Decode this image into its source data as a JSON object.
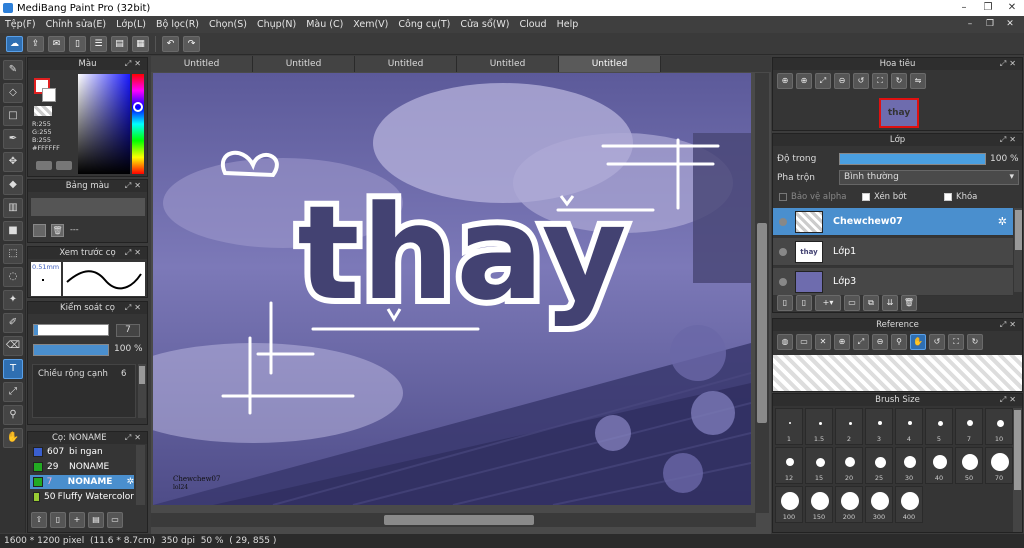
{
  "window": {
    "title": "MediBang Paint Pro (32bit)",
    "controls": [
      "–",
      "❐",
      "✕"
    ]
  },
  "menu": {
    "items": [
      "Tệp(F)",
      "Chỉnh sửa(E)",
      "Lớp(L)",
      "Bộ lọc(R)",
      "Chọn(S)",
      "Chụp(N)",
      "Màu (C)",
      "Xem(V)",
      "Công cụ(T)",
      "Cửa sổ(W)",
      "Cloud",
      "Help"
    ],
    "right_controls": [
      "–",
      "❐",
      "✕"
    ]
  },
  "toolbar": {
    "icons": [
      "cloud-icon",
      "share-icon",
      "comment-icon",
      "page-icon",
      "document-icon",
      "list-icon",
      "grid-icon"
    ],
    "undo_label": "↶",
    "redo_label": "↷"
  },
  "tools": [
    "brush-tool-icon",
    "eraser-icon",
    "rectangle-icon",
    "pen-icon",
    "move-icon",
    "bucket-icon",
    "gradient-icon",
    "fill-rect-icon",
    "select-rect-icon",
    "lasso-icon",
    "magic-wand-icon",
    "select-pen-icon",
    "select-eraser-icon",
    "text-icon",
    "operation-icon",
    "eyedropper-icon",
    "hand-icon"
  ],
  "color_panel": {
    "title": "Màu",
    "r": "R:255",
    "g": "G:255",
    "b": "B:255",
    "hex": "#FFFFFF",
    "fg_color": "#e02020",
    "bg_color": "#ffffff"
  },
  "palette_panel": {
    "title": "Bảng màu",
    "value": "---"
  },
  "brush_preview_panel": {
    "title": "Xem trước cọ",
    "size": "0.51mm"
  },
  "brush_control_panel": {
    "title": "Kiểm soát cọ",
    "size_value": "7",
    "opacity_value": "100 %",
    "option_label": "Chiều rộng cạnh",
    "option_value": "6",
    "size_fraction": 0.06,
    "opacity_fraction": 1.0
  },
  "brush_list_panel": {
    "title": "Cọ: NONAME",
    "items": [
      {
        "num": "607",
        "name": "bi ngan",
        "color": "#3a5fcf"
      },
      {
        "num": "29",
        "name": "NONAME",
        "color": "#22aa22"
      },
      {
        "num": "7",
        "name": "NONAME",
        "color": "#22aa22"
      },
      {
        "num": "50",
        "name": "Fluffy Watercolor",
        "color": "#99cc33"
      }
    ],
    "selected_index": 2
  },
  "tabs": [
    "Untitled",
    "Untitled",
    "Untitled",
    "Untitled",
    "Untitled"
  ],
  "active_tab": 4,
  "artwork": {
    "text": "thay",
    "signature_line1": "Chewchew07",
    "signature_line2": "lol24"
  },
  "status": {
    "canvas_size": "1600 * 1200 pixel",
    "physical": "(11.6 * 8.7cm)",
    "dpi": "350 dpi",
    "zoom": "50 %",
    "coords": "( 29, 855 )"
  },
  "navigator": {
    "title": "Hoa tiêu",
    "thumb_text": "thay"
  },
  "layers": {
    "title": "Lớp",
    "opacity_label": "Độ trong",
    "opacity_value": "100 %",
    "opacity_fraction": 1.0,
    "blend_label": "Pha trộn",
    "blend_value": "Bình thường",
    "protect_alpha": "Bảo vệ alpha",
    "clipping": "Xén bớt",
    "lock": "Khóa",
    "items": [
      {
        "name": "Chewchew07",
        "selected": true
      },
      {
        "name": "Lớp1",
        "selected": false
      },
      {
        "name": "Lớp3",
        "selected": false
      }
    ]
  },
  "reference": {
    "title": "Reference"
  },
  "brush_size": {
    "title": "Brush Size",
    "sizes": [
      "1",
      "1.5",
      "2",
      "3",
      "4",
      "5",
      "7",
      "10",
      "12",
      "15",
      "20",
      "25",
      "30",
      "40",
      "50",
      "70",
      "100",
      "150",
      "200",
      "300",
      "400"
    ]
  }
}
